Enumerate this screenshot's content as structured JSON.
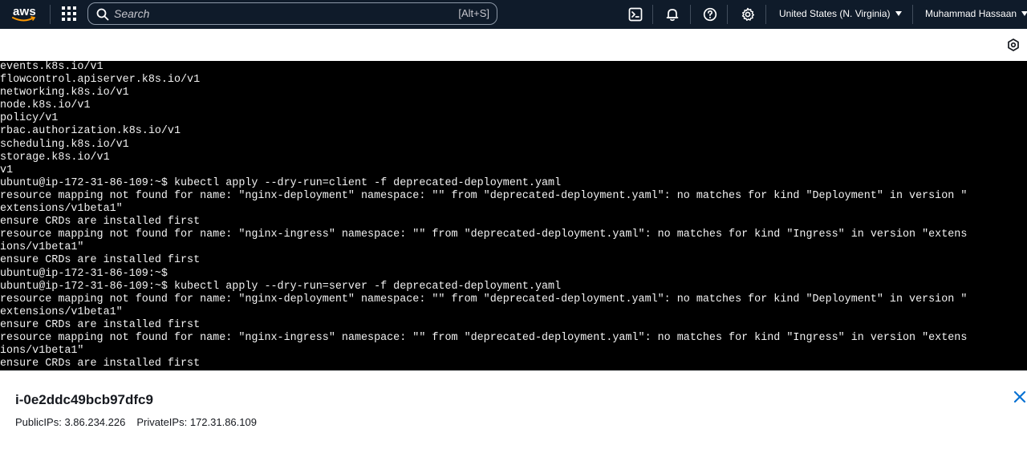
{
  "topbar": {
    "logo_text": "aws",
    "search_placeholder": "Search",
    "search_shortcut": "[Alt+S]",
    "region": "United States (N. Virginia)",
    "user": "Muhammad Hassaan",
    "icons": [
      "apps-grid-icon",
      "search-icon",
      "cloudshell-icon",
      "notifications-bell-icon",
      "help-icon",
      "settings-gear-icon"
    ]
  },
  "terminal": {
    "lines": [
      "events.k8s.io/v1",
      "flowcontrol.apiserver.k8s.io/v1",
      "networking.k8s.io/v1",
      "node.k8s.io/v1",
      "policy/v1",
      "rbac.authorization.k8s.io/v1",
      "scheduling.k8s.io/v1",
      "storage.k8s.io/v1",
      "v1",
      "ubuntu@ip-172-31-86-109:~$ kubectl apply --dry-run=client -f deprecated-deployment.yaml",
      "resource mapping not found for name: \"nginx-deployment\" namespace: \"\" from \"deprecated-deployment.yaml\": no matches for kind \"Deployment\" in version \"",
      "extensions/v1beta1\"",
      "ensure CRDs are installed first",
      "resource mapping not found for name: \"nginx-ingress\" namespace: \"\" from \"deprecated-deployment.yaml\": no matches for kind \"Ingress\" in version \"extens",
      "ions/v1beta1\"",
      "ensure CRDs are installed first",
      "ubuntu@ip-172-31-86-109:~$",
      "ubuntu@ip-172-31-86-109:~$ kubectl apply --dry-run=server -f deprecated-deployment.yaml",
      "resource mapping not found for name: \"nginx-deployment\" namespace: \"\" from \"deprecated-deployment.yaml\": no matches for kind \"Deployment\" in version \"",
      "extensions/v1beta1\"",
      "ensure CRDs are installed first",
      "resource mapping not found for name: \"nginx-ingress\" namespace: \"\" from \"deprecated-deployment.yaml\": no matches for kind \"Ingress\" in version \"extens",
      "ions/v1beta1\"",
      "ensure CRDs are installed first"
    ]
  },
  "panel": {
    "instance_id": "i-0e2ddc49bcb97dfc9",
    "public_ips_label": "PublicIPs:",
    "public_ips": "3.86.234.226",
    "private_ips_label": "PrivateIPs:",
    "private_ips": "172.31.86.109"
  },
  "colors": {
    "nav_bg": "#0f1b2a",
    "terminal_bg": "#000000",
    "terminal_text": "#f2f2f2",
    "close_icon": "#0972d3"
  }
}
